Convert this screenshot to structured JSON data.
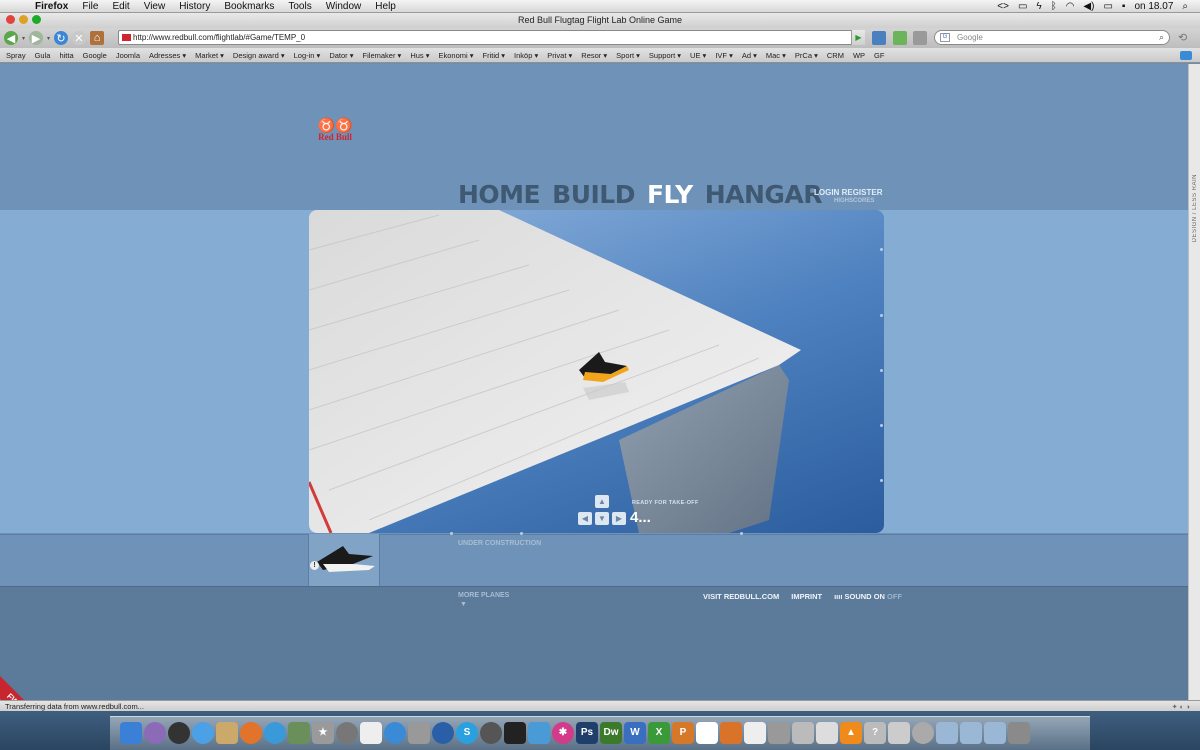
{
  "menubar": {
    "app": "Firefox",
    "items": [
      "File",
      "Edit",
      "View",
      "History",
      "Bookmarks",
      "Tools",
      "Window",
      "Help"
    ],
    "clock": "on 18.07"
  },
  "window": {
    "title": "Red Bull Flugtag Flight Lab Online Game",
    "url": "http://www.redbull.com/flightlab/#Game/TEMP_0",
    "search_placeholder": "Google"
  },
  "bookmarks": [
    "Spray",
    "Gula",
    "hitta",
    "Google",
    "Joomla",
    "Adresses ▾",
    "Market ▾",
    "Design award ▾",
    "Log-in ▾",
    "Dator ▾",
    "Filemaker ▾",
    "Hus ▾",
    "Ekonomi ▾",
    "Fritid ▾",
    "Inköp ▾",
    "Privat ▾",
    "Resor ▾",
    "Sport ▾",
    "Support ▾",
    "UE ▾",
    "IVF ▾",
    "Ad ▾",
    "Mac ▾",
    "PrCa ▾",
    "CRM",
    "WP",
    "GF"
  ],
  "site": {
    "logo_text": "Red Bull",
    "side_text": "DESIGN / LESS RAIN",
    "nav": {
      "home": "HOME",
      "build": "BUILD",
      "fly": "FLY",
      "hangar": "HANGAR"
    },
    "login": "LOGIN",
    "register": "REGISTER",
    "highscores": "HIGHSCORES",
    "game": {
      "ready_label": "READY FOR TAKE-OFF",
      "countdown": "4..."
    },
    "under_construction": "UNDER CONSTRUCTION",
    "more_planes": "MORE PLANES",
    "footer": {
      "visit": "VISIT REDBULL.COM",
      "imprint": "IMPRINT",
      "sound_prefix": "SOUND",
      "sound_on": "ON",
      "sound_off": "OFF"
    },
    "ribbon": "FWA"
  },
  "status": {
    "text": "Transferring data from www.redbull.com..."
  },
  "colors": {
    "page_bg": "#6f93b8",
    "band": "#85acd3",
    "brand_red": "#d4232b"
  }
}
